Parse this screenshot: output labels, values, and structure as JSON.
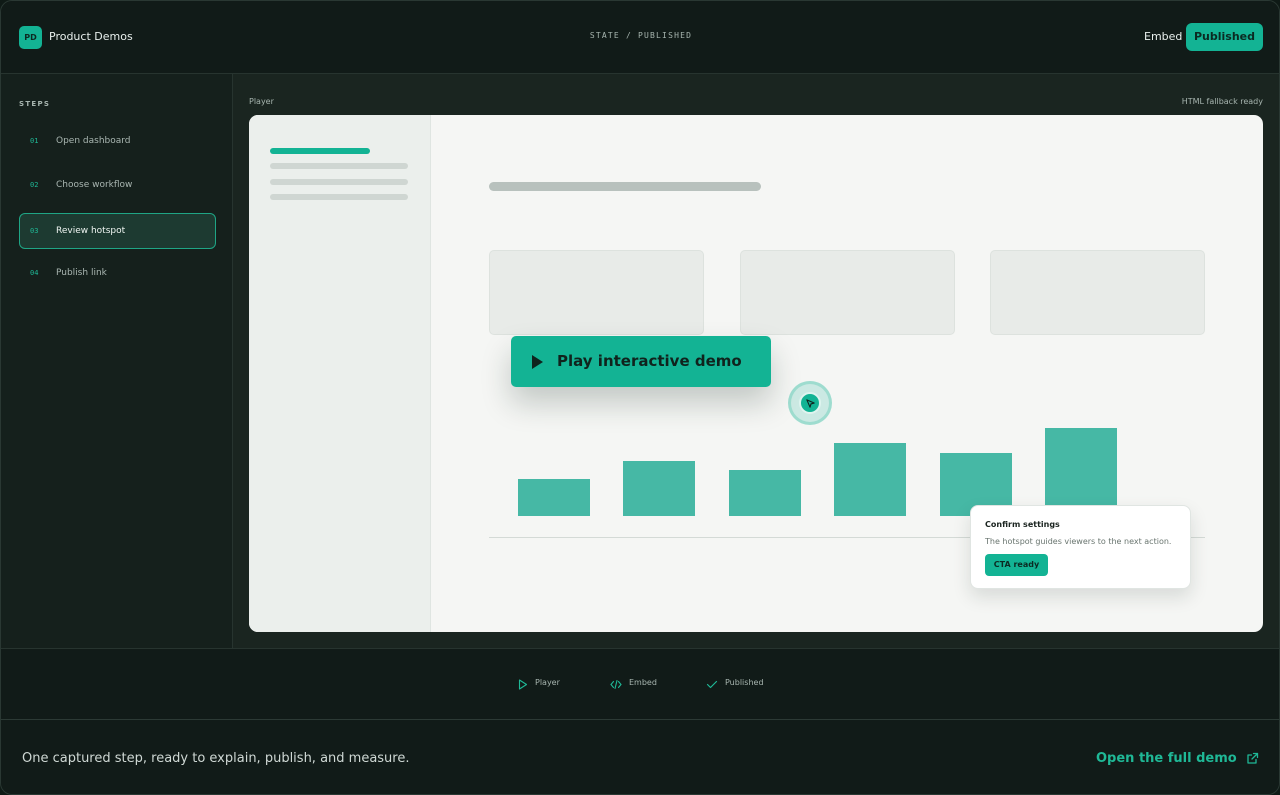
{
  "header": {
    "logo_text": "PD",
    "app_title": "Product Demos",
    "state_label": "STATE / PUBLISHED",
    "embed_label": "Embed",
    "published_label": "Published"
  },
  "sidebar": {
    "heading": "STEPS",
    "steps": [
      {
        "num": "01",
        "label": "Open dashboard",
        "active": false
      },
      {
        "num": "02",
        "label": "Choose workflow",
        "active": false
      },
      {
        "num": "03",
        "label": "Review hotspot",
        "active": true
      },
      {
        "num": "04",
        "label": "Publish link",
        "active": false
      }
    ]
  },
  "main": {
    "player_label": "Player",
    "fallback_label": "HTML fallback ready",
    "play_label": "Play interactive demo",
    "tooltip": {
      "title": "Confirm settings",
      "body": "The hotspot guides viewers to the next action.",
      "cta": "CTA ready"
    },
    "bar_values": [
      0.37,
      0.55,
      0.46,
      0.73,
      0.63,
      0.88
    ]
  },
  "status": {
    "items": [
      {
        "icon": "play-outline-icon",
        "label": "Player"
      },
      {
        "icon": "code-icon",
        "label": "Embed"
      },
      {
        "icon": "check-icon",
        "label": "Published"
      }
    ]
  },
  "footer": {
    "tagline": "One captured step, ready to explain, publish, and measure.",
    "link_label": "Open the full demo"
  },
  "colors": {
    "accent": "#13b394",
    "background": "#111b18",
    "bar": "#46b8a5"
  }
}
